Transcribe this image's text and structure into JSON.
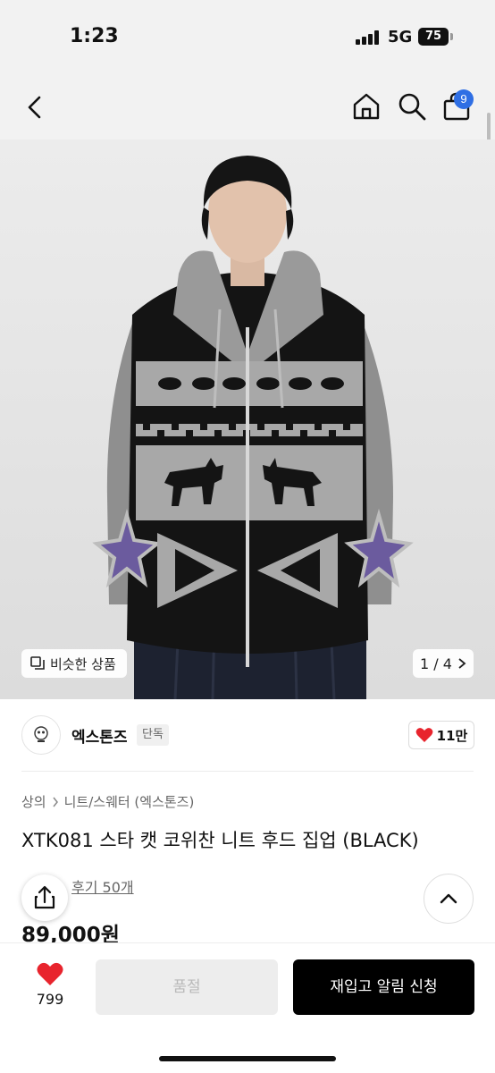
{
  "status_bar": {
    "time": "1:23",
    "network": "5G",
    "battery": "75"
  },
  "nav": {
    "cart_count": "9"
  },
  "gallery": {
    "similar_label": "비슷한 상품",
    "page_indicator": "1 / 4"
  },
  "brand": {
    "name": "엑스톤즈",
    "tag": "단독",
    "likes": "11만"
  },
  "product": {
    "breadcrumb": [
      "상의",
      "니트/스웨터 (엑스톤즈)"
    ],
    "title": "XTK081 스타 캣 코위찬 니트 후드 집업 (BLACK)",
    "review_text": "후기 50개",
    "price": "89,000원"
  },
  "bottom": {
    "heart_count": "799",
    "soldout_label": "품절",
    "restock_label": "재입고 알림 신청"
  },
  "colors": {
    "badge_blue": "#2f6fe4",
    "heart_red": "#e8242d",
    "cta_black": "#000000"
  }
}
